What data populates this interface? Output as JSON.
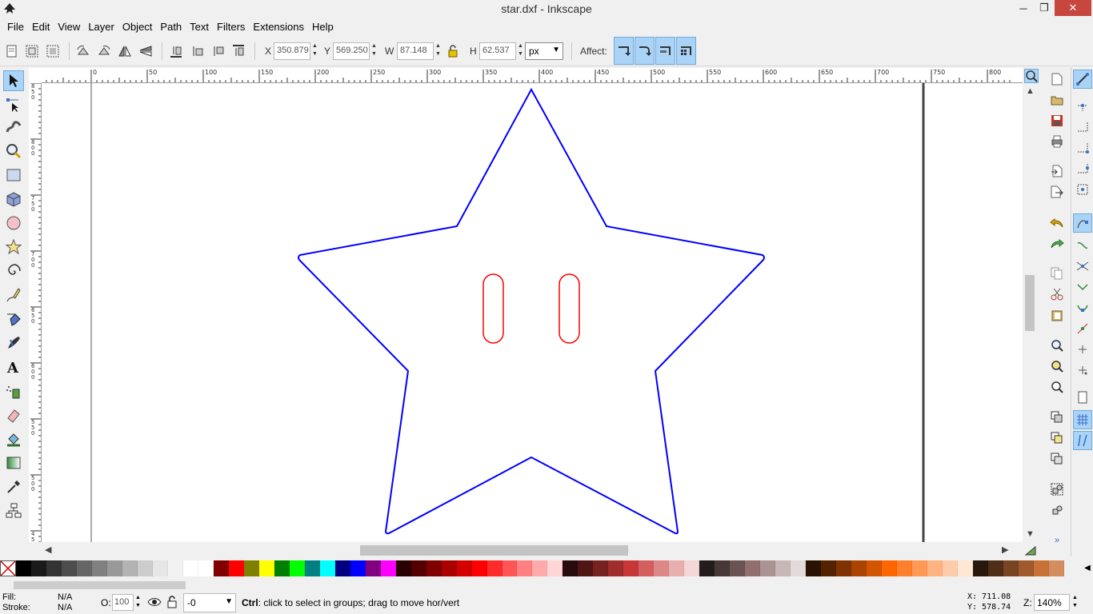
{
  "window": {
    "title": "star.dxf - Inkscape",
    "minimize": "─",
    "maximize": "❐",
    "close": "✕"
  },
  "menu": [
    "File",
    "Edit",
    "View",
    "Layer",
    "Object",
    "Path",
    "Text",
    "Filters",
    "Extensions",
    "Help"
  ],
  "toolbar": {
    "x_label": "X",
    "x_value": "350.879",
    "y_label": "Y",
    "y_value": "569.250",
    "w_label": "W",
    "w_value": "87.148",
    "h_label": "H",
    "h_value": "62.537",
    "unit": "px",
    "affect_label": "Affect:"
  },
  "ruler": {
    "h_labels": [
      "0",
      "50",
      "100",
      "150",
      "200",
      "250",
      "300",
      "350",
      "400",
      "450",
      "500",
      "550",
      "600",
      "650",
      "700",
      "750",
      "800"
    ],
    "v_labels": [
      "850",
      "800",
      "750",
      "700",
      "650",
      "600",
      "550",
      "500",
      "450"
    ]
  },
  "status": {
    "fill_label": "Fill:",
    "fill_value": "N/A",
    "stroke_label": "Stroke:",
    "stroke_value": "N/A",
    "opacity_label": "O:",
    "opacity_value": "100",
    "layer_value": "-0",
    "message_bold": "Ctrl",
    "message": ": click to select in groups; drag to move hor/vert",
    "x_coord": "X:  711.08",
    "y_coord": "Y:  578.74",
    "zoom_label": "Z:",
    "zoom_value": "140%"
  },
  "colors": {
    "star_stroke": "#0000ff",
    "eyes_stroke": "#ff0000",
    "active_tool": "#aad4f7",
    "close_button": "#c7463e"
  },
  "palette": [
    "#000000",
    "#1a1a1a",
    "#333333",
    "#4d4d4d",
    "#666666",
    "#808080",
    "#999999",
    "#b3b3b3",
    "#cccccc",
    "#e6e6e6",
    "#f2f2f2",
    "#ffffff",
    "#ffffff",
    "#800000",
    "#ff0000",
    "#808000",
    "#ffff00",
    "#008000",
    "#00ff00",
    "#008080",
    "#00ffff",
    "#000080",
    "#0000ff",
    "#800080",
    "#ff00ff",
    "#2b0000",
    "#550000",
    "#800000",
    "#aa0000",
    "#d40000",
    "#ff0000",
    "#ff2a2a",
    "#ff5555",
    "#ff8080",
    "#ffaaaa",
    "#ffd5d5",
    "#280b0b",
    "#501616",
    "#782121",
    "#a02c2c",
    "#c83737",
    "#d35f5f",
    "#de8787",
    "#e9afaf",
    "#f4d7d7",
    "#241c1c",
    "#483737",
    "#6c5353",
    "#916f6f",
    "#ac9393",
    "#c8b7b7",
    "#e3dbdb",
    "#2b1100",
    "#552200",
    "#803300",
    "#aa4400",
    "#d45500",
    "#ff6600",
    "#ff7f2a",
    "#ff9955",
    "#ffb380",
    "#ffccaa",
    "#ffe6d5",
    "#28170b",
    "#502d16",
    "#784421",
    "#a05a2c",
    "#c87137",
    "#d38d5f"
  ]
}
